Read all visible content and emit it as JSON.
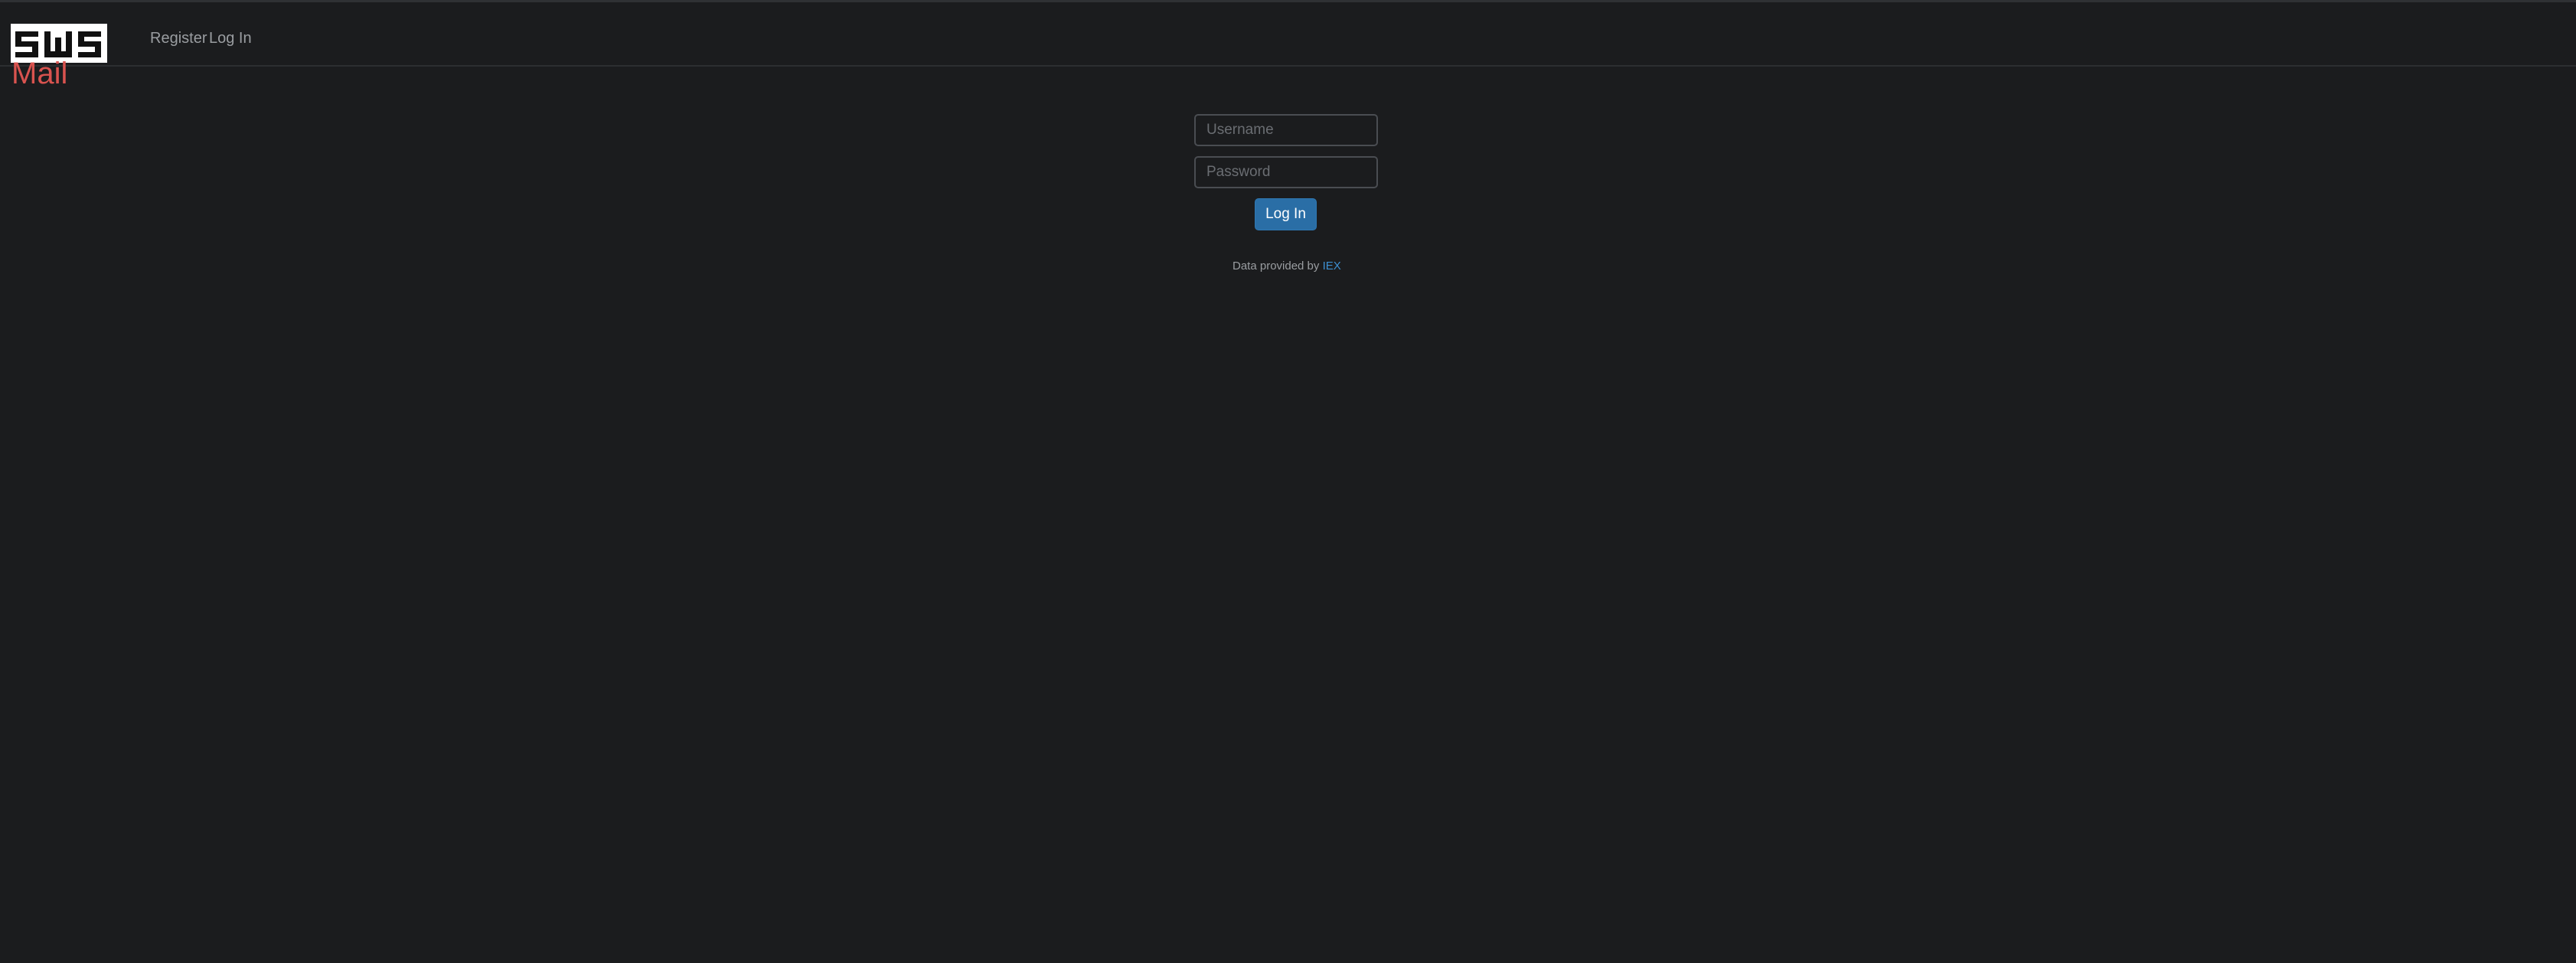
{
  "brand": {
    "logo_text": "SWS",
    "subtitle": "Mail",
    "subtitle_color": "#d9534f"
  },
  "nav": {
    "register_label": "Register",
    "login_label": "Log In"
  },
  "login_form": {
    "username_placeholder": "Username",
    "username_value": "",
    "password_placeholder": "Password",
    "password_value": "",
    "submit_label": "Log In",
    "submit_color": "#2a6ea6"
  },
  "footer": {
    "credit_prefix": "Data provided by",
    "credit_link": "IEX",
    "link_color": "#3d8fd1"
  }
}
